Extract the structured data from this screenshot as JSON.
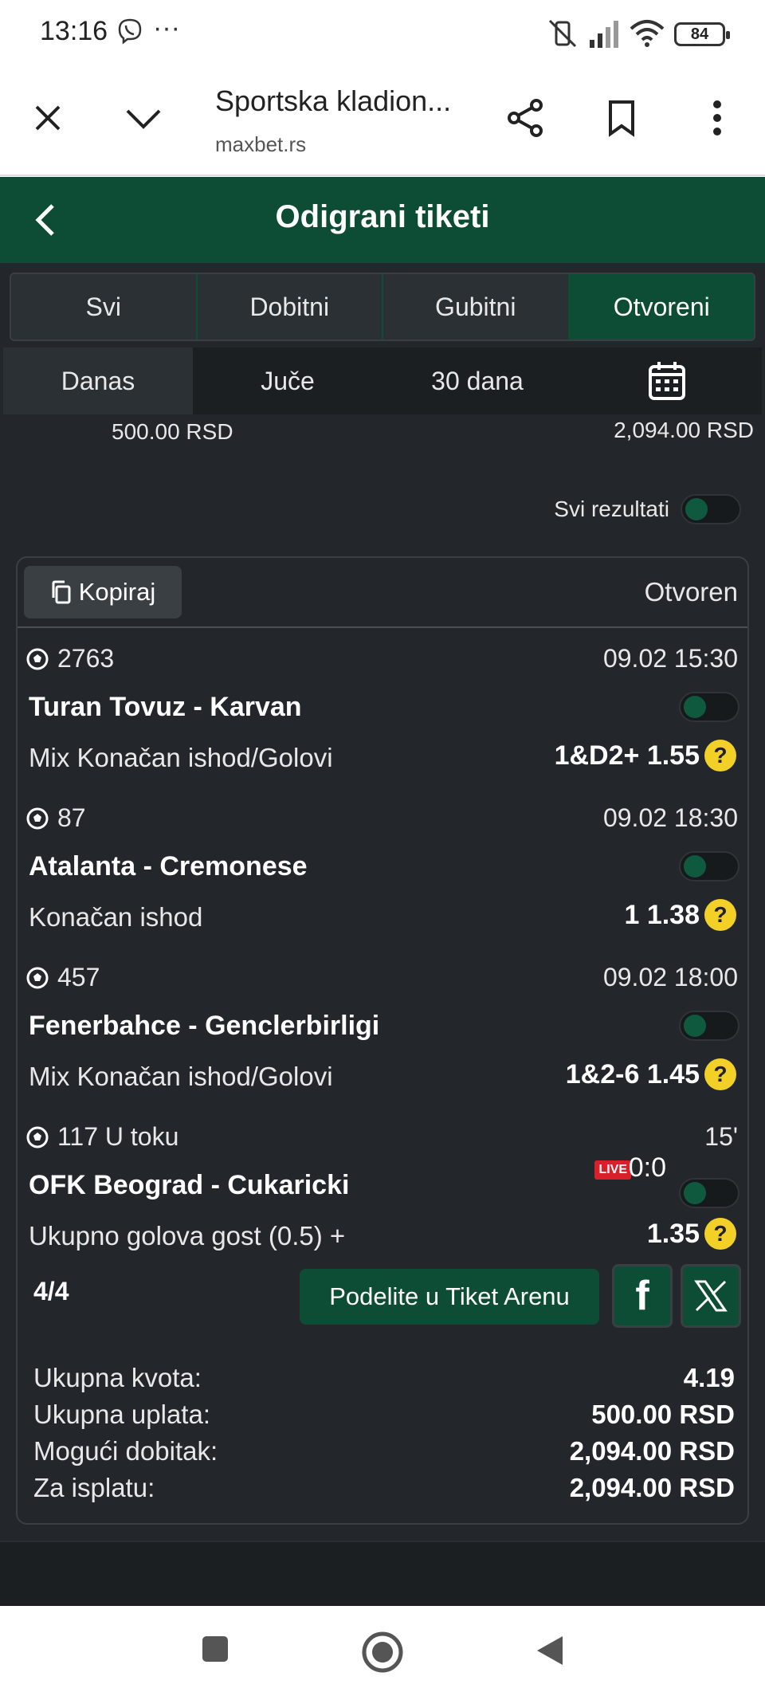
{
  "status_bar": {
    "time": "13:16",
    "dots": "···",
    "battery": "84"
  },
  "browser": {
    "title": "Sportska kladion...",
    "url": "maxbet.rs",
    "icons": [
      "close-icon",
      "chevron-down-icon",
      "share-icon",
      "bookmark-icon",
      "more-vert-icon"
    ]
  },
  "header": {
    "title": "Odigrani tiketi"
  },
  "tabs": [
    {
      "label": "Svi",
      "active": false
    },
    {
      "label": "Dobitni",
      "active": false
    },
    {
      "label": "Gubitni",
      "active": false
    },
    {
      "label": "Otvoreni",
      "active": true
    }
  ],
  "periods": [
    {
      "label": "Danas",
      "active": true
    },
    {
      "label": "Juče",
      "active": false
    },
    {
      "label": "30 dana",
      "active": false
    }
  ],
  "summary": {
    "left": "500.00 RSD",
    "right": "2,094.00 RSD"
  },
  "all_results_label": "Svi rezultati",
  "ticket": {
    "copy_label": "Kopiraj",
    "status": "Otvoren",
    "matches": [
      {
        "code": "2763",
        "time": "09.02 15:30",
        "teams": "Turan Tovuz - Karvan",
        "market": "Mix Konačan ishod/Golovi",
        "pick": "1&D2+ 1.55"
      },
      {
        "code": "87",
        "time": "09.02 18:30",
        "teams": "Atalanta - Cremonese",
        "market": "Konačan ishod",
        "pick": "1 1.38"
      },
      {
        "code": "457",
        "time": "09.02 18:00",
        "teams": "Fenerbahce - Genclerbirligi",
        "market": "Mix Konačan ishod/Golovi",
        "pick": "1&2-6 1.45"
      },
      {
        "code": "117 U toku",
        "time": "15'",
        "teams": "OFK Beograd - Cukaricki",
        "market": "Ukupno golova gost (0.5) +",
        "pick": "1.35",
        "live": "LIVE",
        "score": "0:0"
      }
    ],
    "help_mark": "?",
    "count": "4/4",
    "share_label": "Podelite u Tiket Arenu",
    "facebook_glyph": "f",
    "totals": [
      {
        "label": "Ukupna kvota:",
        "value": "4.19"
      },
      {
        "label": "Ukupna uplata:",
        "value": "500.00 RSD"
      },
      {
        "label": "Mogući dobitak:",
        "value": "2,094.00 RSD"
      },
      {
        "label": "Za isplatu:",
        "value": "2,094.00 RSD"
      }
    ]
  },
  "colors": {
    "brand_green": "#0d4d36",
    "background": "#23272b",
    "help_yellow": "#f2d027",
    "live_red": "#d8202a"
  }
}
